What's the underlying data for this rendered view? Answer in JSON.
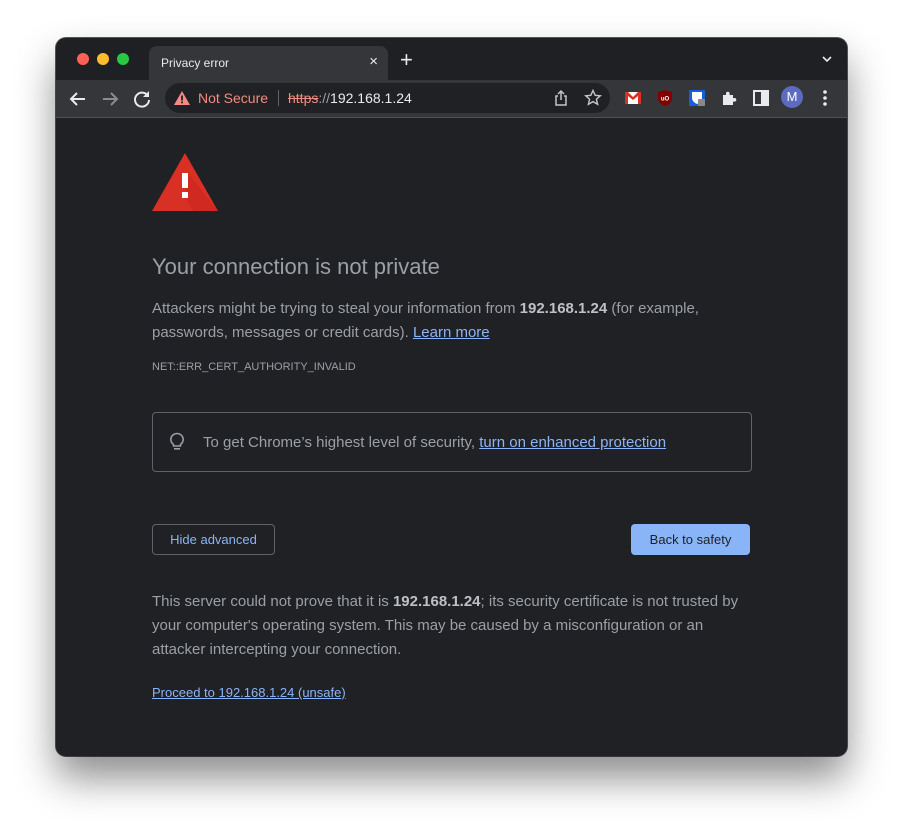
{
  "browser": {
    "tab": {
      "title": "Privacy error",
      "close_icon": "×"
    },
    "new_tab_icon": "+",
    "address_bar": {
      "security_label": "Not Secure",
      "url_scheme": "https",
      "url_separator": "://",
      "url_host": "192.168.1.24"
    },
    "profile_initial": "M",
    "extensions": [
      "gmail-icon",
      "ublock-origin-icon",
      "bitwarden-icon",
      "puzzle-extensions-icon",
      "side-panel-icon"
    ],
    "colors": {
      "not_secure": "#f28b82",
      "link": "#8ab4f8",
      "warning_red": "#d93025"
    }
  },
  "page": {
    "heading": "Your connection is not private",
    "intro": {
      "before": "Attackers might be trying to steal your information from ",
      "host": "192.168.1.24",
      "after": " (for example, passwords, messages or credit cards). ",
      "learn_more": "Learn more"
    },
    "error_code": "NET::ERR_CERT_AUTHORITY_INVALID",
    "enhanced": {
      "text": "To get Chrome’s highest level of security, ",
      "link": "turn on enhanced protection"
    },
    "buttons": {
      "hide_advanced": "Hide advanced",
      "back_to_safety": "Back to safety"
    },
    "details": {
      "before": "This server could not prove that it is ",
      "host": "192.168.1.24",
      "after": "; its security certificate is not trusted by your computer's operating system. This may be caused by a misconfiguration or an attacker intercepting your connection."
    },
    "proceed_link": "Proceed to 192.168.1.24 (unsafe)"
  }
}
